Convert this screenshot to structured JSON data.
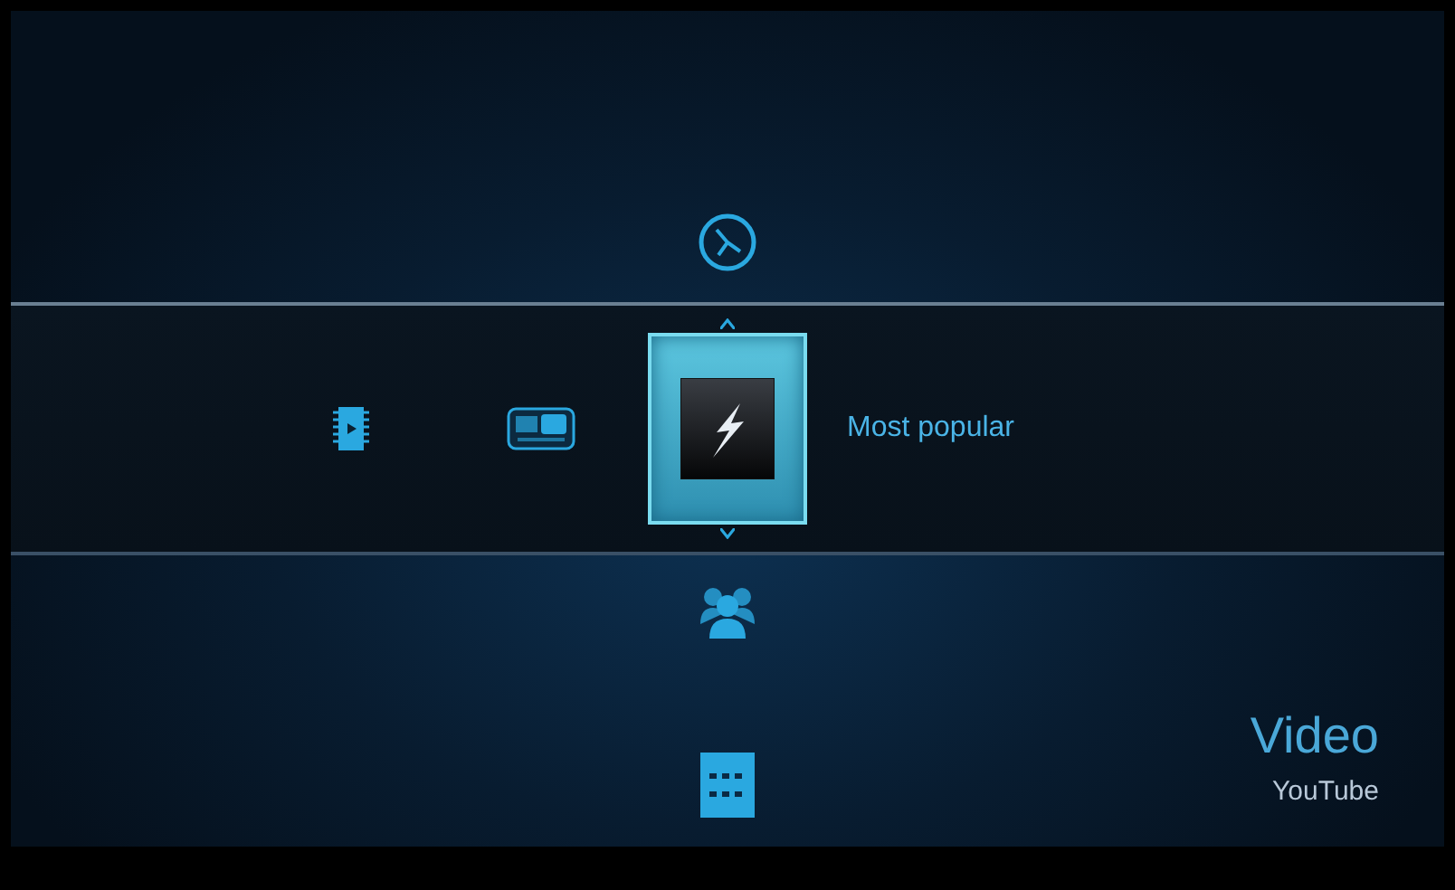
{
  "above": [
    {
      "kind": "clock"
    }
  ],
  "left": [
    {
      "kind": "film"
    },
    {
      "kind": "youtube"
    }
  ],
  "focused": {
    "kind": "bolt",
    "label": "Most popular"
  },
  "below": [
    {
      "kind": "people"
    },
    {
      "kind": "rating"
    }
  ],
  "section": {
    "title": "Video",
    "subtitle": "YouTube"
  }
}
